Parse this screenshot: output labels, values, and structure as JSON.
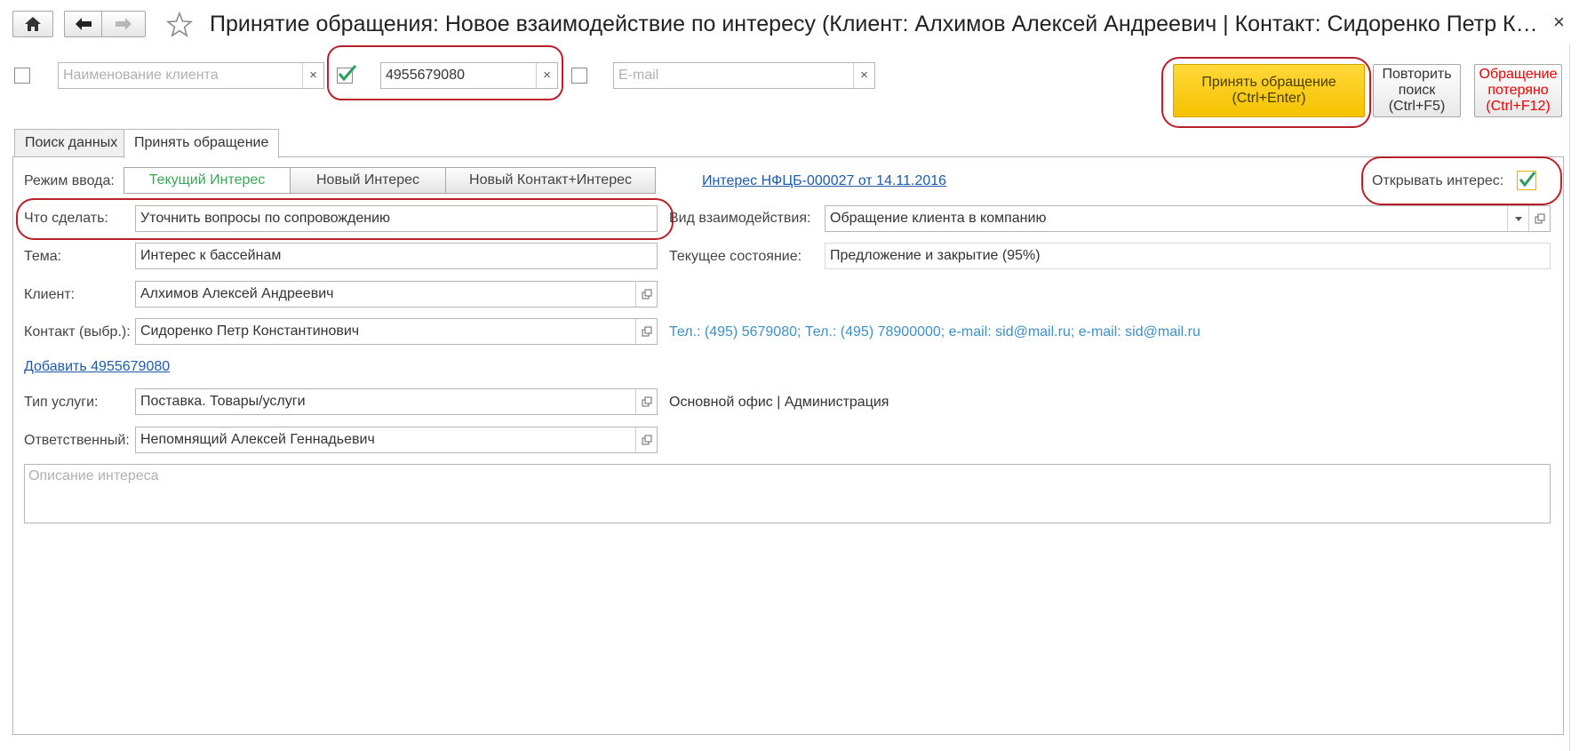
{
  "window": {
    "title": "Принятие обращения: Новое взаимодействие по интересу (Клиент: Алхимов Алексей Андреевич | Контакт: Сидоренко Петр Констан...",
    "close_glyph": "×"
  },
  "search": {
    "client_name_placeholder": "Наименование клиента",
    "phone_value": "4955679080",
    "email_placeholder": "E-mail",
    "clear_glyph": "×"
  },
  "actions": {
    "accept_line1": "Принять обращение",
    "accept_line2": "(Ctrl+Enter)",
    "repeat_line1": "Повторить",
    "repeat_line2": "поиск",
    "repeat_line3": "(Ctrl+F5)",
    "lost_line1": "Обращение",
    "lost_line2": "потеряно",
    "lost_line3": "(Ctrl+F12)"
  },
  "tabs": [
    {
      "label": "Поиск данных"
    },
    {
      "label": "Принять обращение"
    }
  ],
  "form": {
    "mode_label": "Режим ввода:",
    "modes": [
      "Текущий Интерес",
      "Новый Интерес",
      "Новый Контакт+Интерес"
    ],
    "interest_link": "Интерес НФЦБ-000027 от 14.11.2016",
    "open_interest_label": "Открывать интерес:",
    "todo_label": "Что сделать:",
    "todo_value": "Уточнить вопросы по сопровождению",
    "interaction_type_label": "Вид взаимодействия:",
    "interaction_type_value": "Обращение клиента в компанию",
    "topic_label": "Тема:",
    "topic_value": "Интерес к бассейнам",
    "state_label": "Текущее состояние:",
    "state_value": "Предложение и закрытие (95%)",
    "client_label": "Клиент:",
    "client_value": "Алхимов Алексей Андреевич",
    "contact_label": "Контакт (выбр.):",
    "contact_value": "Сидоренко Петр Константинович",
    "contact_info": "Тел.: (495) 5679080; Тел.: (495) 78900000; e-mail: sid@mail.ru; e-mail: sid@mail.ru",
    "add_phone_link": "Добавить 4955679080",
    "service_type_label": "Тип услуги:",
    "service_type_value": "Поставка. Товары/услуги",
    "office_info": "Основной офис | Администрация",
    "responsible_label": "Ответственный:",
    "responsible_value": "Непомнящий Алексей Геннадьевич",
    "description_placeholder": "Описание интереса"
  },
  "colors": {
    "accent_yellow": "#f5c200",
    "highlight_ring": "#b8202a",
    "check_green": "#2a9d5c",
    "link_blue": "#1e5aa8",
    "lost_red": "#e60000"
  }
}
